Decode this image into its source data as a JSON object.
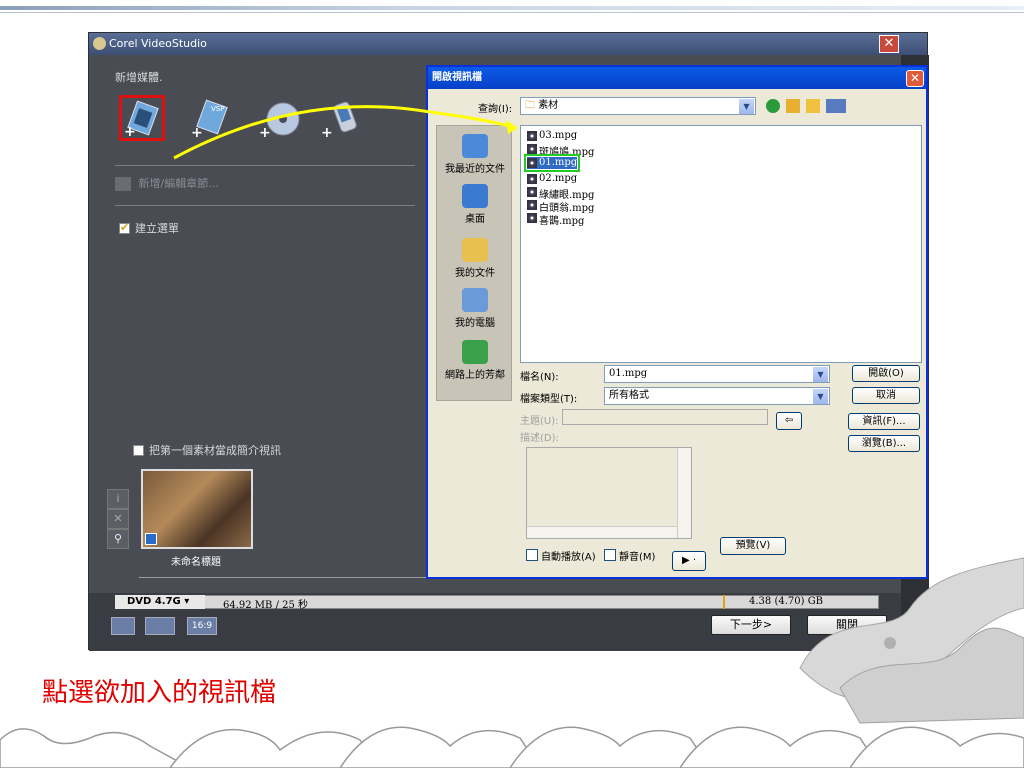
{
  "app": {
    "title": "Corel VideoStudio",
    "section_title": "新增媒體.",
    "disabled_action": "新增/編輯章節...",
    "create_menu_label": "建立選單",
    "intro_video_label": "把第一個素材當成簡介視訊",
    "clip_title": "未命名標題",
    "disc_type": "DVD 4.7G",
    "size_used": "64.92 MB / 25 秒",
    "capacity": "4.38 (4.70) GB",
    "next_label": "下一步>",
    "close_label": "關閉",
    "aspect_label": "16:9"
  },
  "dialog": {
    "title": "開啟視訊檔",
    "look_in_label": "查詢(I):",
    "look_in_value": "素材",
    "places": [
      "我最近的文件",
      "桌面",
      "我的文件",
      "我的電腦",
      "網路上的芳鄰"
    ],
    "files": [
      "03.mpg",
      "斑鳩鳩.mpg",
      "01.mpg",
      "02.mpg",
      "綠繡眼.mpg",
      "白頭翁.mpg",
      "喜鵲.mpg"
    ],
    "filename_label": "檔名(N):",
    "filename_value": "01.mpg",
    "filetype_label": "檔案類型(T):",
    "filetype_value": "所有格式",
    "subject_label": "主題(U):",
    "desc_label": "描述(D):",
    "open_btn": "開啟(O)",
    "cancel_btn": "取消",
    "info_btn": "資訊(F)...",
    "browse_btn": "瀏覽(B)...",
    "preview_btn": "預覽(V)",
    "autoplay_label": "自動播放(A)",
    "mute_label": "靜音(M)"
  },
  "caption": "點選欲加入的視訊檔",
  "colors": {
    "highlight_red": "#e00000",
    "highlight_green": "#22cc22",
    "arrow_yellow": "#ffff00"
  }
}
